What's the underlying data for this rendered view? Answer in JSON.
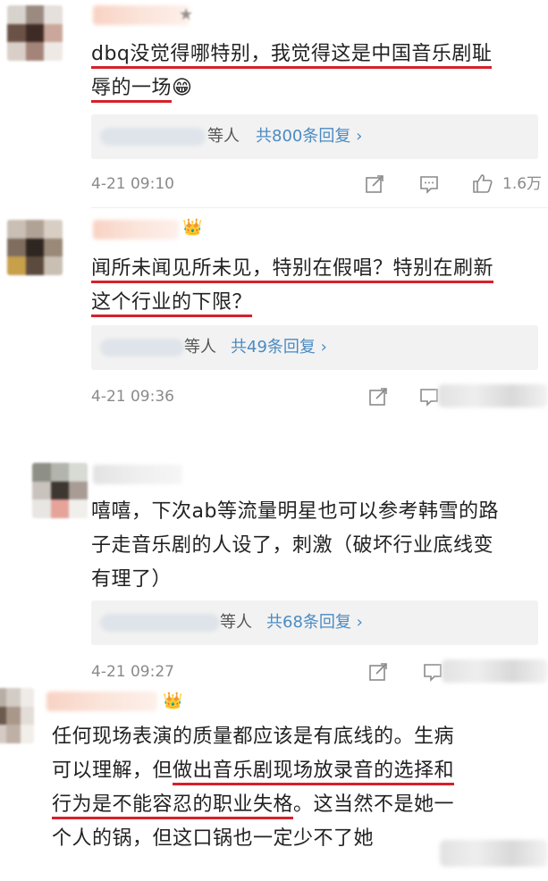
{
  "comments": [
    {
      "text_a": "dbq没觉得哪特别，我觉得这是中国音乐剧耻",
      "text_b": "辱的一场",
      "emoji": "😁",
      "replies_who": "等人",
      "replies_count": "共800条回复 ›",
      "time": "4-21 09:10",
      "likes": "1.6万"
    },
    {
      "text_a": "闻所未闻见所未见，特别在假唱？特别在刷新",
      "text_b": "这个行业的下限？",
      "badge": "👑",
      "replies_who": "等人",
      "replies_count": "共49条回复 ›",
      "time": "4-21 09:36"
    },
    {
      "text_a": "嘻嘻，下次ab等流量明星也可以参考韩雪的路",
      "text_b": "子走音乐剧的人设了，刺激（破坏行业底线变",
      "text_c": "有理了）",
      "replies_who": "等人",
      "replies_count": "共68条回复 ›",
      "time": "4-21 09:27"
    },
    {
      "badge": "👑",
      "text_a": "任何现场表演的质量都应该是有底线的。生病",
      "text_b1": "可以理解，但",
      "text_b2": "做出音乐剧现场放录音的选择和",
      "text_c1": "行为是不能容忍的职业失格",
      "text_c2": "。这当然不是她一",
      "text_d": "个人的锅，但这口锅也一定少不了她"
    }
  ],
  "icons": {
    "share": "share-icon",
    "comment": "comment-icon",
    "like": "thumbs-up-icon"
  },
  "colors": {
    "underline": "#d6202b",
    "link": "#4a8bc2",
    "meta": "#8a8a8a"
  }
}
